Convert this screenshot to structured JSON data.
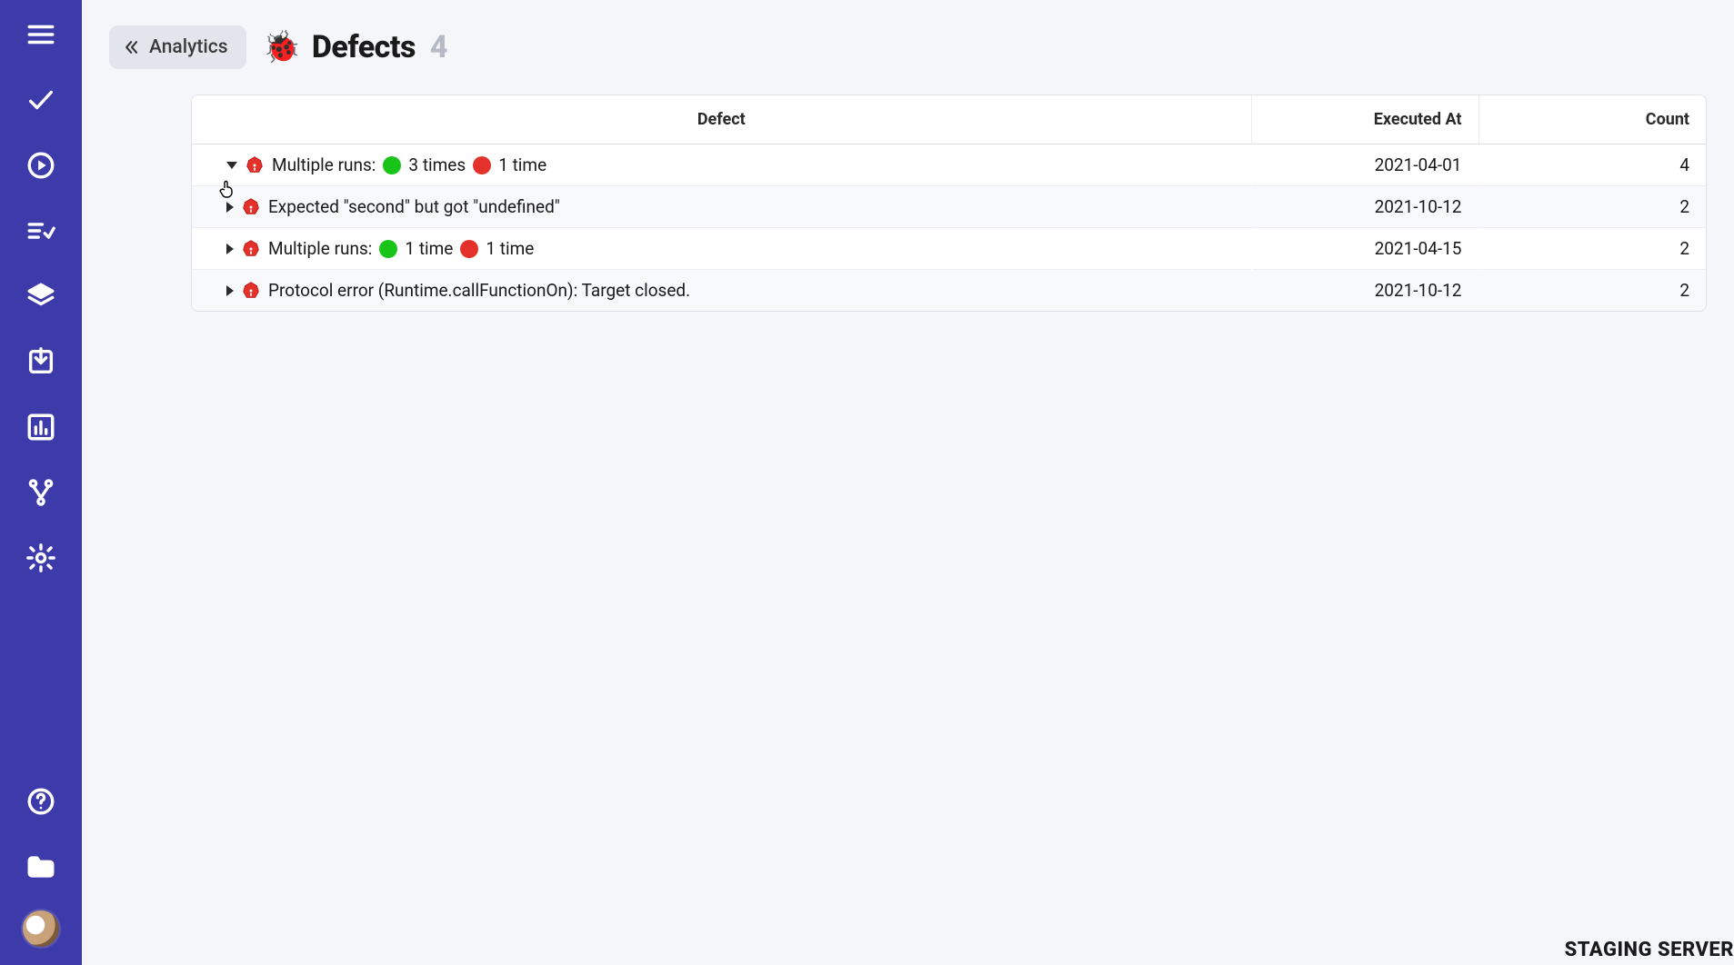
{
  "header": {
    "back_label": "Analytics",
    "title_emoji": "🐞",
    "title": "Defects",
    "count": "4"
  },
  "table": {
    "columns": [
      "Defect",
      "Executed At",
      "Count"
    ],
    "rows": [
      {
        "expanded": true,
        "prefix": "Multiple runs:",
        "parts": [
          {
            "dot": "green",
            "text": "3 times"
          },
          {
            "dot": "red",
            "text": "1 time"
          }
        ],
        "executed_at": "2021-04-01",
        "count": "4"
      },
      {
        "expanded": false,
        "text": "Expected \"second\" but got \"undefined\"",
        "executed_at": "2021-10-12",
        "count": "2"
      },
      {
        "expanded": false,
        "prefix": "Multiple runs:",
        "parts": [
          {
            "dot": "green",
            "text": "1 time"
          },
          {
            "dot": "red",
            "text": "1 time"
          }
        ],
        "executed_at": "2021-04-15",
        "count": "2"
      },
      {
        "expanded": false,
        "text": "Protocol error (Runtime.callFunctionOn): Target closed.",
        "executed_at": "2021-10-12",
        "count": "2"
      }
    ]
  },
  "footer": {
    "env_label": "STAGING SERVER"
  },
  "colors": {
    "sidebar_bg": "#3d3aaa",
    "page_bg": "#f5f6fa"
  }
}
